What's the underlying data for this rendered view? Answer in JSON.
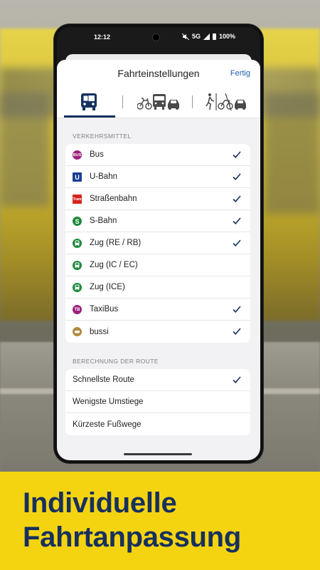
{
  "status_bar": {
    "time": "12:12",
    "network": "5G",
    "battery": "100%"
  },
  "sheet": {
    "title": "Fahrteinstellungen",
    "done_label": "Fertig",
    "tabs": [
      {
        "name": "bus-only",
        "icon": "bus-icon"
      },
      {
        "name": "bike-and-transit",
        "icon": "bike-bus-car-icon"
      },
      {
        "name": "walk-bike-car",
        "icon": "walk-bike-car-icon"
      }
    ],
    "transport_section_label": "VERKEHRSMITTEL",
    "transport_modes": [
      {
        "label": "Bus",
        "icon": "bus-badge",
        "badge": "BUS",
        "color": "#9c1f7a",
        "checked": true
      },
      {
        "label": "U-Bahn",
        "icon": "ubahn-badge",
        "badge": "U",
        "color": "#1c3f94",
        "checked": true
      },
      {
        "label": "Straßenbahn",
        "icon": "tram-badge",
        "badge": "Tram",
        "color": "#d6231b",
        "checked": true
      },
      {
        "label": "S-Bahn",
        "icon": "sbahn-badge",
        "badge": "S",
        "color": "#1b8a3a",
        "checked": true
      },
      {
        "label": "Zug (RE / RB)",
        "icon": "train-badge",
        "color": "#1b8a3a",
        "checked": true
      },
      {
        "label": "Zug (IC / EC)",
        "icon": "train-badge",
        "color": "#1b8a3a",
        "checked": false
      },
      {
        "label": "Zug (ICE)",
        "icon": "train-badge",
        "color": "#1b8a3a",
        "checked": false
      },
      {
        "label": "TaxiBus",
        "icon": "taxibus-badge",
        "badge": "TB",
        "color": "#9c1f7a",
        "checked": true
      },
      {
        "label": "bussi",
        "icon": "bussi-badge",
        "color": "#b08a3e",
        "checked": true
      }
    ],
    "route_section_label": "BERECHNUNG DER ROUTE",
    "route_options": [
      {
        "label": "Schnellste Route",
        "checked": true
      },
      {
        "label": "Wenigste Umstiege",
        "checked": false
      },
      {
        "label": "Kürzeste Fußwege",
        "checked": false
      }
    ]
  },
  "banner": {
    "line1": "Individuelle",
    "line2": "Fahrtanpassung"
  },
  "colors": {
    "banner": "#f4d411",
    "banner_text": "#17305e",
    "accent": "#15315f",
    "link": "#1f5eb5"
  }
}
